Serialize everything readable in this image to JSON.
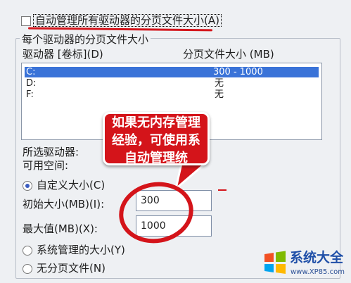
{
  "auto_manage": {
    "checked": false,
    "label": "自动管理所有驱动器的分页文件大小(A)"
  },
  "group": {
    "title": "每个驱动器的分页文件大小"
  },
  "drive_list": {
    "col_drive": "驱动器 [卷标](D)",
    "col_size": "分页文件大小 (MB)",
    "rows": [
      {
        "drive": "C:",
        "size": "300 - 1000",
        "selected": true
      },
      {
        "drive": "D:",
        "size": "无",
        "selected": false
      },
      {
        "drive": "F:",
        "size": "无",
        "selected": false
      }
    ]
  },
  "selected_drive": {
    "drive_label": "所选驱动器:",
    "space_label": "可用空间:"
  },
  "options": {
    "custom_label": "自定义大小(C)",
    "initial_label": "初始大小(MB)(I):",
    "initial_value": "300",
    "max_label": "最大值(MB)(X):",
    "max_value": "1000",
    "system_label": "系统管理的大小(Y)",
    "none_label": "无分页文件(N)"
  },
  "callout": {
    "lines": [
      "如果无内存管理",
      "经验，可使用系",
      "自动管理统"
    ]
  },
  "watermark": {
    "brand": "系统大全",
    "url": "www.XP85.com"
  },
  "colors": {
    "annotation_red": "#d4141a",
    "selection_blue": "#3a73d8"
  }
}
